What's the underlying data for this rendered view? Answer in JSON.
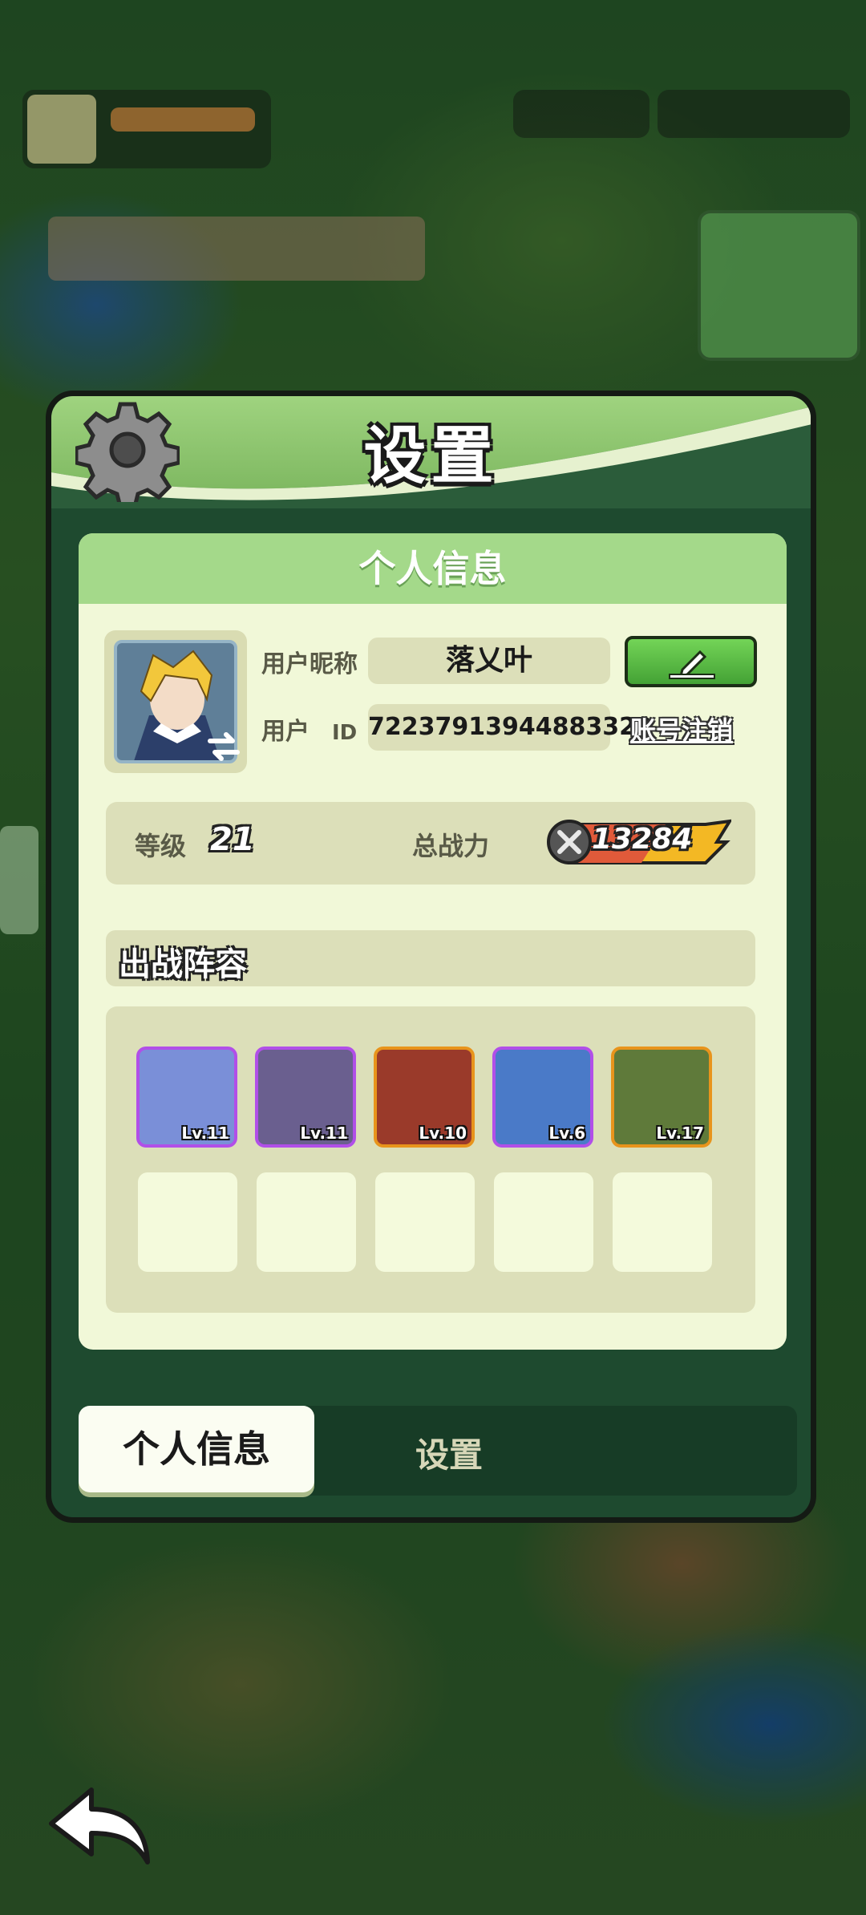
{
  "panel": {
    "title": "设置",
    "section_title": "个人信息"
  },
  "profile": {
    "nickname_label": "用户昵称",
    "nickname": "落乂叶",
    "id_label": "用户",
    "id_suffix": "ID",
    "user_id": "72237913944883329",
    "logout_label": "账号注销"
  },
  "stats": {
    "level_label": "等级",
    "level": "21",
    "power_label": "总战力",
    "power": "13284"
  },
  "lineup": {
    "title": "出战阵容",
    "heroes": [
      {
        "level": "Lv.11",
        "rarity": "purple",
        "color": "#7a8fd8"
      },
      {
        "level": "Lv.11",
        "rarity": "purple",
        "color": "#6a5f8f"
      },
      {
        "level": "Lv.10",
        "rarity": "orange",
        "color": "#9a3a2a"
      },
      {
        "level": "Lv.6",
        "rarity": "purple",
        "color": "#4a7ac8"
      },
      {
        "level": "Lv.17",
        "rarity": "orange",
        "color": "#5f7a3a"
      }
    ]
  },
  "tabs": {
    "active": "个人信息",
    "other": "设置"
  }
}
